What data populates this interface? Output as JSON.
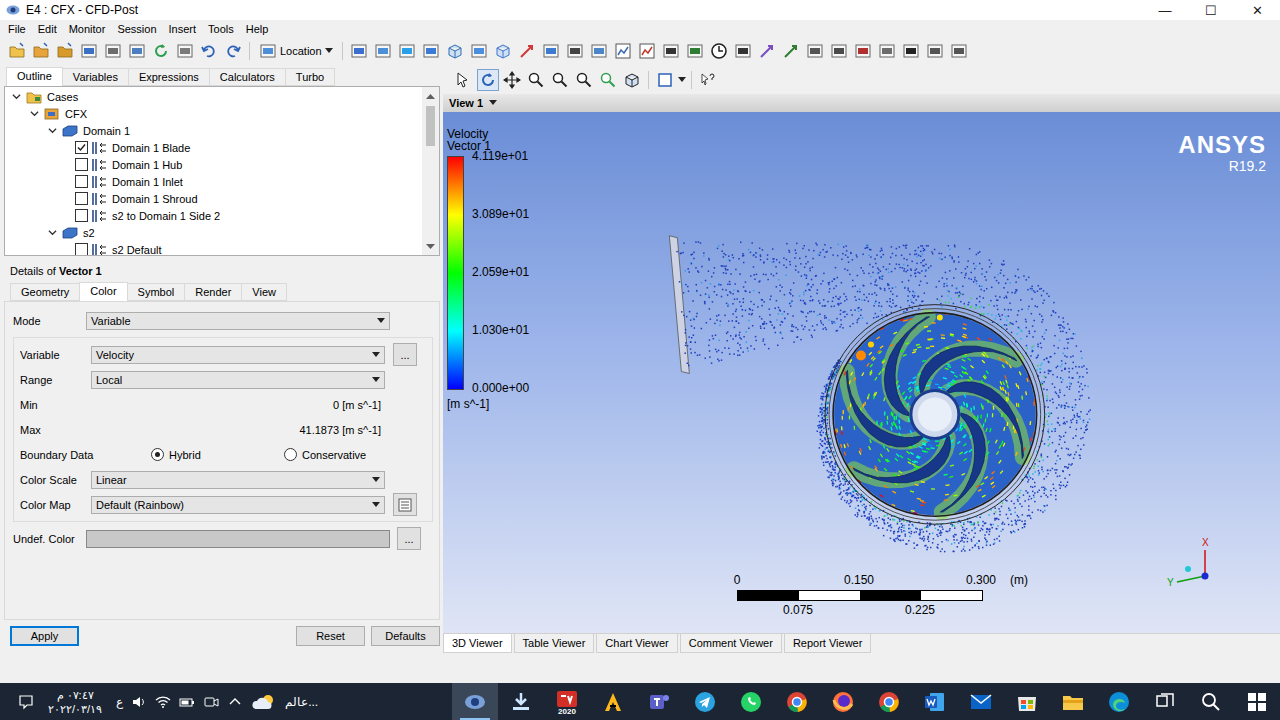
{
  "window": {
    "title": "E4 : CFX - CFD-Post",
    "controls": [
      "—",
      "☐",
      "✕"
    ]
  },
  "menu": [
    "File",
    "Edit",
    "Monitor",
    "Session",
    "Insert",
    "Tools",
    "Help"
  ],
  "toolbar": {
    "location": "Location"
  },
  "outline_tabs": [
    {
      "label": "Outline",
      "selected": true
    },
    {
      "label": "Variables",
      "selected": false
    },
    {
      "label": "Expressions",
      "selected": false
    },
    {
      "label": "Calculators",
      "selected": false
    },
    {
      "label": "Turbo",
      "selected": false
    }
  ],
  "tree": [
    {
      "label": "Cases",
      "kind": "cases",
      "expanded": true,
      "children": [
        {
          "label": "CFX",
          "kind": "case",
          "expanded": true,
          "children": [
            {
              "label": "Domain 1",
              "kind": "domain",
              "expanded": true,
              "children": [
                {
                  "label": "Domain 1 Blade",
                  "kind": "region",
                  "checked": true
                },
                {
                  "label": "Domain 1 Hub",
                  "kind": "region",
                  "checked": false
                },
                {
                  "label": "Domain 1 Inlet",
                  "kind": "region",
                  "checked": false
                },
                {
                  "label": "Domain 1 Shroud",
                  "kind": "region",
                  "checked": false
                },
                {
                  "label": "s2 to Domain 1 Side 2",
                  "kind": "region",
                  "checked": false
                }
              ]
            },
            {
              "label": "s2",
              "kind": "domain",
              "expanded": true,
              "children": [
                {
                  "label": "s2 Default",
                  "kind": "region",
                  "checked": false
                }
              ]
            }
          ]
        }
      ]
    }
  ],
  "details": {
    "title": "Details of",
    "object": "Vector 1",
    "tabs": [
      {
        "label": "Geometry",
        "selected": false
      },
      {
        "label": "Color",
        "selected": true
      },
      {
        "label": "Symbol",
        "selected": false
      },
      {
        "label": "Render",
        "selected": false
      },
      {
        "label": "View",
        "selected": false
      }
    ],
    "mode": {
      "label": "Mode",
      "value": "Variable"
    },
    "fields": [
      {
        "label": "Variable",
        "kind": "dropdown",
        "value": "Velocity",
        "button": "..."
      },
      {
        "label": "Range",
        "kind": "dropdown",
        "value": "Local"
      },
      {
        "label": "Min",
        "kind": "value",
        "value": "0 [m s^-1]"
      },
      {
        "label": "Max",
        "kind": "value",
        "value": "41.1873 [m s^-1]"
      },
      {
        "label": "Boundary Data",
        "kind": "radio",
        "options": [
          {
            "label": "Hybrid",
            "selected": true
          },
          {
            "label": "Conservative",
            "selected": false
          }
        ]
      },
      {
        "label": "Color Scale",
        "kind": "dropdown",
        "value": "Linear"
      },
      {
        "label": "Color Map",
        "kind": "dropdown-edit",
        "value": "Default (Rainbow)"
      }
    ],
    "undef": {
      "label": "Undef. Color",
      "button": "..."
    }
  },
  "buttons": [
    {
      "label": "Apply",
      "focused": true
    },
    {
      "label": "Reset",
      "focused": false
    },
    {
      "label": "Defaults",
      "focused": false
    }
  ],
  "viewer": {
    "view_title": "View 1",
    "legend": {
      "title": "Velocity",
      "subtitle": "Vector 1",
      "ticks": [
        "4.119e+01",
        "3.089e+01",
        "2.059e+01",
        "1.030e+01",
        "0.000e+00"
      ],
      "unit": "[m s^-1]"
    },
    "brand": "ANSYS",
    "version": "R19.2",
    "scale": {
      "top": [
        "0",
        "0.150",
        "0.300"
      ],
      "unit": "(m)",
      "bottom": [
        "0.075",
        "0.225"
      ]
    },
    "axes": [
      "X",
      "Y"
    ],
    "tabs": [
      {
        "label": "3D Viewer",
        "selected": true
      },
      {
        "label": "Table Viewer",
        "selected": false
      },
      {
        "label": "Chart Viewer",
        "selected": false
      },
      {
        "label": "Comment Viewer",
        "selected": false
      },
      {
        "label": "Report Viewer",
        "selected": false
      }
    ]
  },
  "taskbar": {
    "time": "٠٧:٤٧ م",
    "date": "٢٠٢٢/٠٣/١٩",
    "language": "ع",
    "weather": "عالم...",
    "apps": [
      {
        "kind": "cfdpost",
        "active": true,
        "badge": ""
      },
      {
        "kind": "installer",
        "active": false,
        "badge": ""
      },
      {
        "kind": "solidworks",
        "active": false,
        "badge": "2020"
      },
      {
        "kind": "ansys",
        "active": false,
        "badge": ""
      },
      {
        "kind": "teams",
        "active": false,
        "badge": ""
      },
      {
        "kind": "telegram",
        "active": false,
        "badge": ""
      },
      {
        "kind": "whatsapp",
        "active": false,
        "badge": ""
      },
      {
        "kind": "chrome",
        "active": false,
        "badge": ""
      },
      {
        "kind": "firefox",
        "active": false,
        "badge": ""
      },
      {
        "kind": "chrome",
        "active": false,
        "badge": ""
      },
      {
        "kind": "word",
        "active": false,
        "badge": ""
      },
      {
        "kind": "mail",
        "active": false,
        "badge": ""
      },
      {
        "kind": "store",
        "active": false,
        "badge": ""
      },
      {
        "kind": "explorer",
        "active": false,
        "badge": ""
      },
      {
        "kind": "edge",
        "active": false,
        "badge": ""
      },
      {
        "kind": "taskview",
        "active": false,
        "badge": ""
      },
      {
        "kind": "search",
        "active": false,
        "badge": ""
      },
      {
        "kind": "windows",
        "active": false,
        "badge": ""
      }
    ]
  }
}
